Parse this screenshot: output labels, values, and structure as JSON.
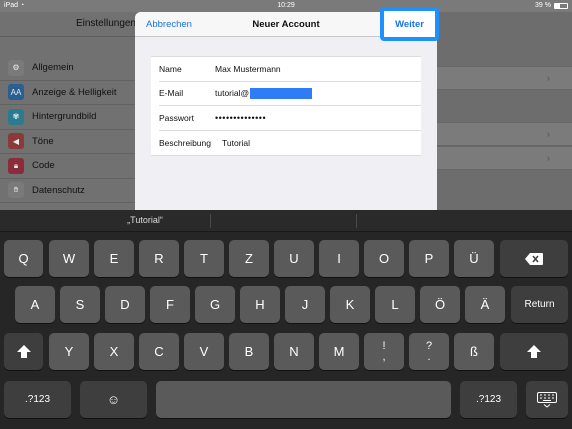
{
  "status_bar": {
    "carrier": "iPad",
    "time": "10:29",
    "battery": "39 %",
    "battery_level": 0.39
  },
  "settings": {
    "sidebar_title": "Einstellungen",
    "items": [
      {
        "label": "Allgemein",
        "icon": "gear-icon",
        "color": "#7a7a7a"
      },
      {
        "label": "Anzeige & Helligkeit",
        "icon": "brightness-icon",
        "color": "#2a5f93"
      },
      {
        "label": "Hintergrundbild",
        "icon": "wallpaper-icon",
        "color": "#2b7a8f"
      },
      {
        "label": "Töne",
        "icon": "speaker-icon",
        "color": "#8a3a3a"
      },
      {
        "label": "Code",
        "icon": "lock-icon",
        "color": "#8a2c3a"
      },
      {
        "label": "Datenschutz",
        "icon": "hand-icon",
        "color": "#7a7a7a"
      }
    ]
  },
  "modal": {
    "cancel_label": "Abbrechen",
    "title": "Neuer Account",
    "next_label": "Weiter",
    "highlight_color": "#1e90ff",
    "fields": {
      "name_label": "Name",
      "name_value": "Max Mustermann",
      "email_label": "E-Mail",
      "email_value": "tutorial@",
      "password_label": "Passwort",
      "password_value": "••••••••••••••",
      "description_label": "Beschreibung",
      "description_value": "Tutorial"
    }
  },
  "keyboard": {
    "suggestion": "„Tutorial“",
    "rows": [
      [
        "Q",
        "W",
        "E",
        "R",
        "T",
        "Z",
        "U",
        "I",
        "O",
        "P",
        "Ü"
      ],
      [
        "A",
        "S",
        "D",
        "F",
        "G",
        "H",
        "J",
        "K",
        "L",
        "Ö",
        "Ä"
      ],
      [
        "Y",
        "X",
        "C",
        "V",
        "B",
        "N",
        "M"
      ]
    ],
    "punct_keys": [
      {
        "top": "!",
        "bottom": ","
      },
      {
        "top": "?",
        "bottom": "."
      }
    ],
    "sharp_s": "ß",
    "return_label": "Return",
    "numbers_label": ".?123",
    "emoji": "☺"
  }
}
